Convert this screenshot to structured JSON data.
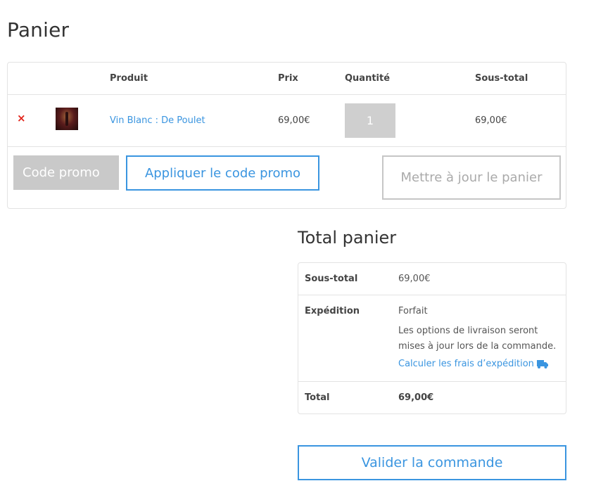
{
  "page": {
    "title": "Panier"
  },
  "cart": {
    "headers": {
      "product": "Produit",
      "price": "Prix",
      "quantity": "Quantité",
      "subtotal": "Sous-total"
    },
    "items": [
      {
        "remove_icon": "×",
        "name": "Vin Blanc : De Poulet",
        "price": "69,00€",
        "quantity": "1",
        "subtotal": "69,00€"
      }
    ],
    "coupon": {
      "placeholder": "Code promo",
      "apply_label": "Appliquer le code promo"
    },
    "update_label": "Mettre à jour le panier"
  },
  "totals": {
    "title": "Total panier",
    "subtotal_label": "Sous-total",
    "subtotal_value": "69,00€",
    "shipping_label": "Expédition",
    "shipping_method": "Forfait",
    "shipping_description": "Les options de livraison seront mises à jour lors de la commande.",
    "shipping_calc_link": "Calculer les frais d’expédition",
    "total_label": "Total",
    "total_value": "69,00€"
  },
  "checkout": {
    "label": "Valider la commande"
  },
  "colors": {
    "accent": "#3a95e0",
    "remove": "#e2231a",
    "border": "#e3e3e3"
  },
  "icons": {
    "remove": "remove-icon",
    "truck": "truck-icon"
  }
}
